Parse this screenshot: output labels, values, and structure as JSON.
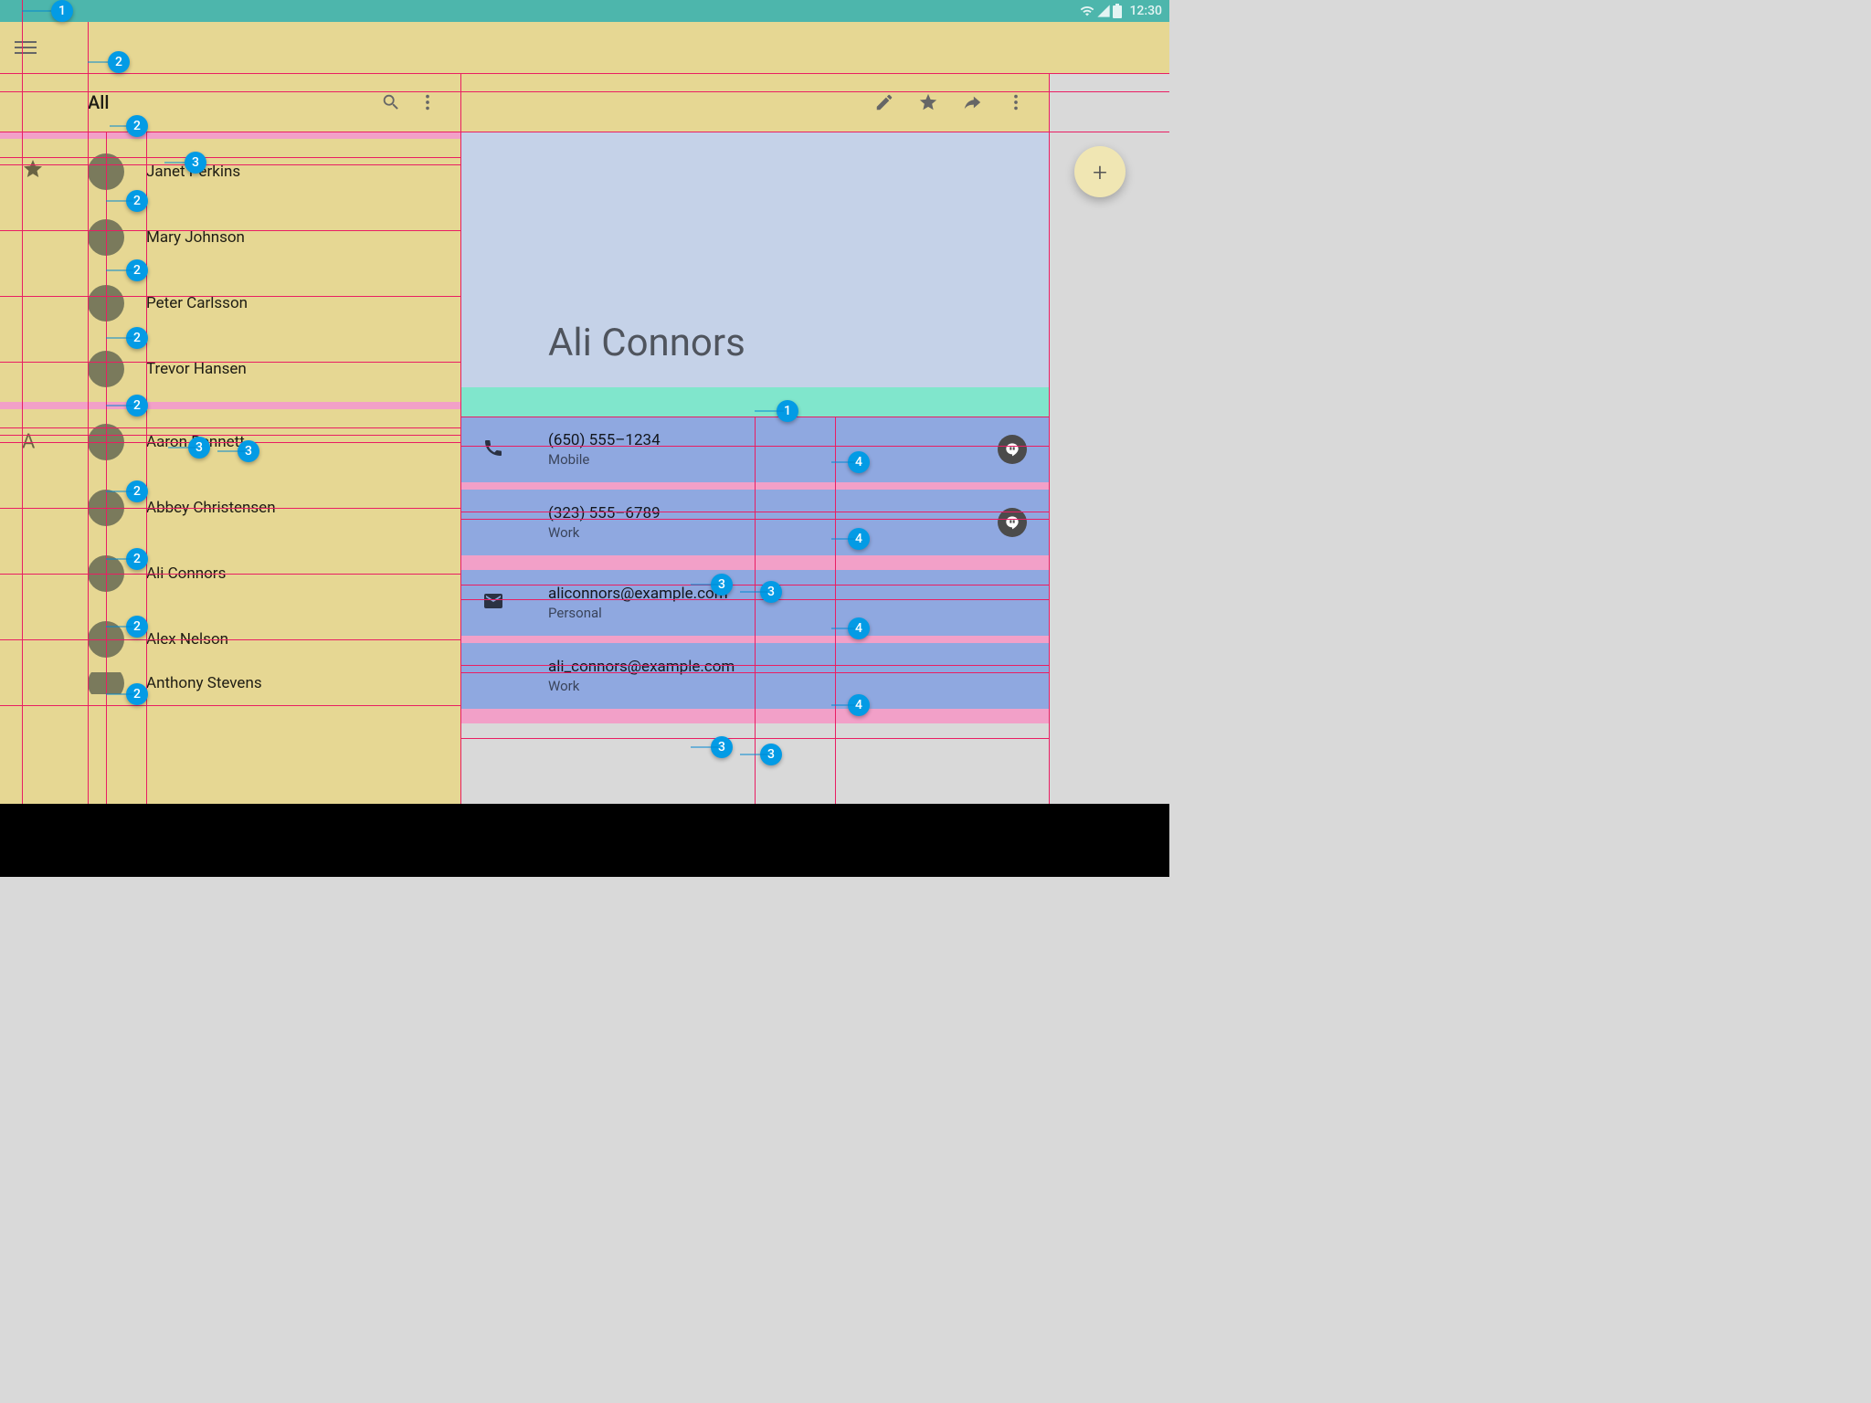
{
  "status_bar": {
    "time": "12:30"
  },
  "left": {
    "title": "All",
    "sections": [
      {
        "mark_type": "star",
        "items": [
          "Janet Perkins",
          "Mary Johnson",
          "Peter Carlsson",
          "Trevor Hansen"
        ]
      },
      {
        "mark_type": "letter",
        "mark": "A",
        "items": [
          "Aaron Bennett",
          "Abbey Christensen",
          "Ali Connors",
          "Alex Nelson",
          "Anthony Stevens"
        ]
      }
    ]
  },
  "detail": {
    "name": "Ali Connors",
    "phones": [
      {
        "number": "(650) 555–1234",
        "label": "Mobile"
      },
      {
        "number": "(323) 555–6789",
        "label": "Work"
      }
    ],
    "emails": [
      {
        "address": "aliconnors@example.com",
        "label": "Personal"
      },
      {
        "address": "ali_connors@example.com",
        "label": "Work"
      }
    ]
  },
  "callouts": {
    "c1": "1",
    "c2": "2",
    "c3": "3",
    "c4": "4"
  }
}
